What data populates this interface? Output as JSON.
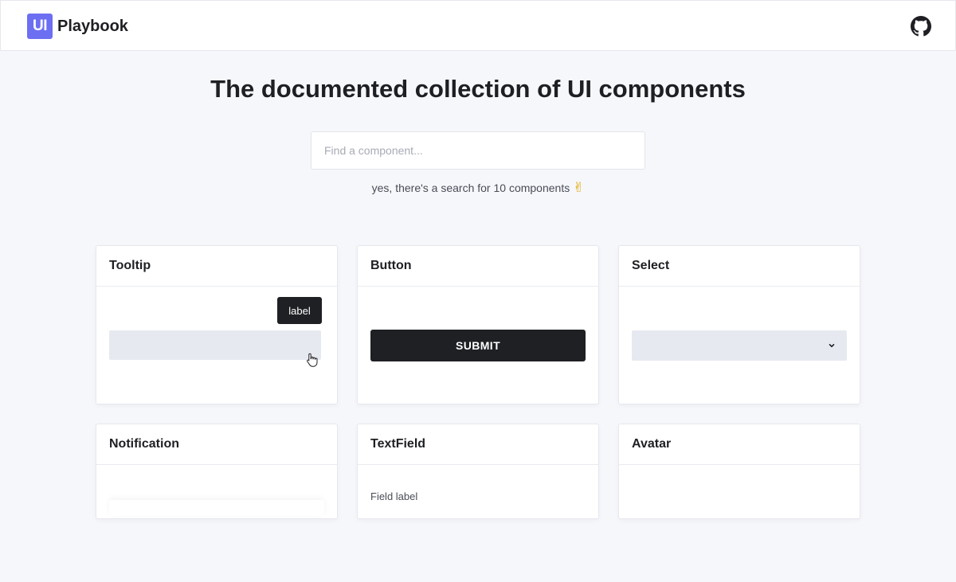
{
  "header": {
    "logo_mark": "UI",
    "logo_text": "Playbook",
    "github_icon": "github-icon"
  },
  "hero": {
    "title": "The documented collection of UI components",
    "search_placeholder": "Find a component...",
    "search_value": "",
    "note_text": "yes, there's a search for 10 components",
    "note_emoji": "✌"
  },
  "cards": [
    {
      "title": "Tooltip",
      "tooltip_label": "label"
    },
    {
      "title": "Button",
      "button_label": "SUBMIT"
    },
    {
      "title": "Select",
      "select_value": ""
    },
    {
      "title": "Notification"
    },
    {
      "title": "TextField",
      "field_label": "Field label"
    },
    {
      "title": "Avatar"
    }
  ],
  "colors": {
    "accent": "#6c6ff2",
    "dark": "#1f2024",
    "background": "#f6f7fb",
    "placeholder_surface": "#e7e9f1"
  }
}
